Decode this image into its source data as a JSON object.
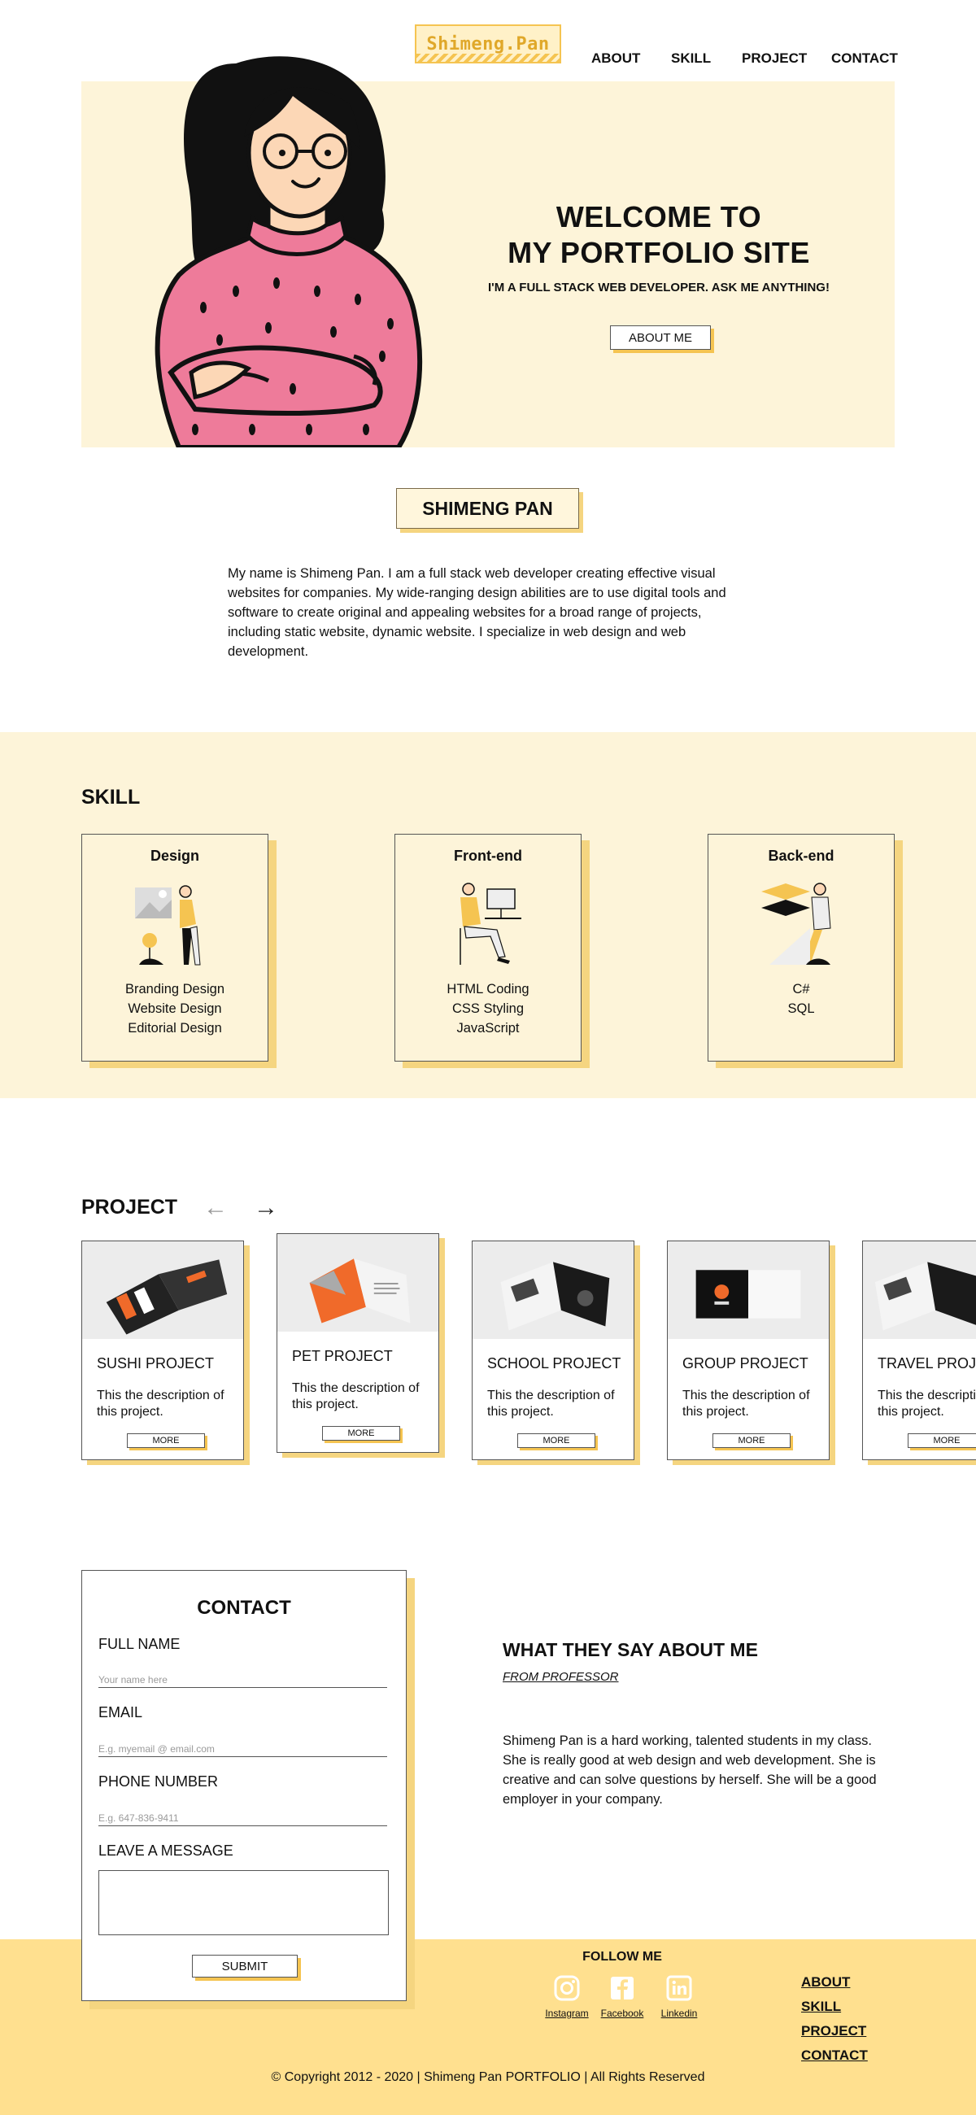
{
  "header": {
    "logo": "Shimeng.Pan",
    "nav": [
      "ABOUT",
      "SKILL",
      "PROJECT",
      "CONTACT"
    ]
  },
  "hero": {
    "title_line1": "WELCOME TO",
    "title_line2": "MY PORTFOLIO SITE",
    "subtitle": "I'M A FULL STACK WEB DEVELOPER. ASK ME ANYTHING!",
    "button": "ABOUT ME"
  },
  "about": {
    "name": "SHIMENG PAN",
    "bio": "My name is Shimeng Pan. I am a full stack web developer creating effective visual websites for companies. My wide-ranging design abilities are to use digital tools and software to create original and appealing websites for a broad range of projects, including static website, dynamic website. I specialize in web design and web development."
  },
  "skill": {
    "title": "SKILL",
    "cards": [
      {
        "title": "Design",
        "items": [
          "Branding Design",
          "Website Design",
          "Editorial Design"
        ]
      },
      {
        "title": "Front-end",
        "items": [
          "HTML Coding",
          "CSS Styling",
          "JavaScript"
        ]
      },
      {
        "title": "Back-end",
        "items": [
          "C#",
          "SQL"
        ]
      }
    ]
  },
  "project": {
    "title": "PROJECT",
    "prev": "←",
    "next": "→",
    "cards": [
      {
        "title": "SUSHI PROJECT",
        "desc": "This the description of this project.",
        "more": "MORE"
      },
      {
        "title": "PET PROJECT",
        "desc": "This the description of this project.",
        "more": "MORE"
      },
      {
        "title": "SCHOOL PROJECT",
        "desc": "This the description of this project.",
        "more": "MORE"
      },
      {
        "title": "GROUP PROJECT",
        "desc": "This the description of this project.",
        "more": "MORE"
      },
      {
        "title": "TRAVEL PROJECT",
        "desc": "This the description of this project.",
        "more": "MORE"
      }
    ]
  },
  "contact": {
    "title": "CONTACT",
    "full_name_label": "FULL NAME",
    "full_name_placeholder": "Your name here",
    "email_label": "EMAIL",
    "email_placeholder": "E.g. myemail @ email.com",
    "phone_label": "PHONE NUMBER",
    "phone_placeholder": "E.g. 647-836-9411",
    "message_label": "LEAVE A MESSAGE",
    "message_value": "",
    "submit": "SUBMIT"
  },
  "testimonial": {
    "title": "WHAT THEY SAY ABOUT ME",
    "from": "FROM  PROFESSOR",
    "quote": "Shimeng Pan is a hard working, talented students in my class. She is really good at web design and web development. She is creative and can solve questions by herself. She will be a good employer in your company."
  },
  "footer": {
    "follow": "FOLLOW ME",
    "social": [
      {
        "label": "Instagram",
        "icon": "instagram-icon"
      },
      {
        "label": "Facebook",
        "icon": "facebook-icon"
      },
      {
        "label": "Linkedin",
        "icon": "linkedin-icon"
      }
    ],
    "links": [
      "ABOUT",
      "SKILL",
      "PROJECT",
      "CONTACT"
    ],
    "copyright": "© Copyright 2012 - 2020  |  Shimeng Pan PORTFOLIO  |  All Rights Reserved"
  },
  "colors": {
    "accent": "#f5c451",
    "shadow": "#f5d580",
    "cream": "#fdf4d9",
    "footer": "#ffe08f"
  }
}
